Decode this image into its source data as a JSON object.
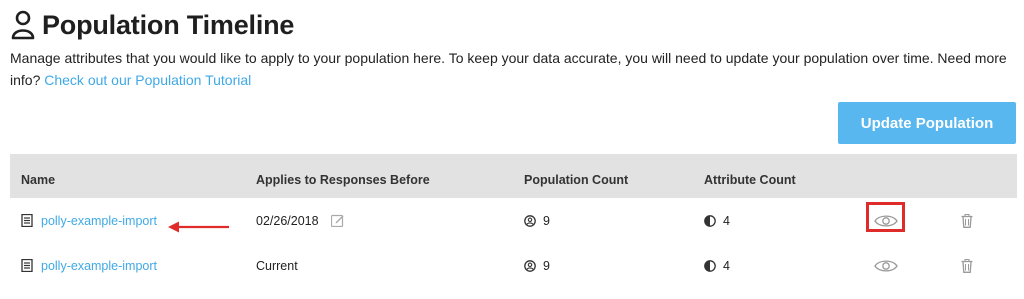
{
  "page": {
    "title": "Population Timeline",
    "title_icon": "person-outline-icon",
    "description": "Manage attributes that you would like to apply to your population here. To keep your data accurate, you will need to update your population over time. Need more info?",
    "tutorial_link": "Check out our Population Tutorial"
  },
  "actions": {
    "update_label": "Update Population"
  },
  "table": {
    "columns": [
      "Name",
      "Applies to Responses Before",
      "Population Count",
      "Attribute Count"
    ],
    "rows": [
      {
        "name": "polly-example-import",
        "applies_before": "02/26/2018",
        "population_count": "9",
        "attribute_count": "4"
      },
      {
        "name": "polly-example-import",
        "applies_before": "Current",
        "population_count": "9",
        "attribute_count": "4"
      }
    ]
  },
  "colors": {
    "accent": "#58b7ef",
    "link": "#3fa9e6",
    "highlight": "#e02b2b",
    "header_bg": "#e2e2e2"
  }
}
